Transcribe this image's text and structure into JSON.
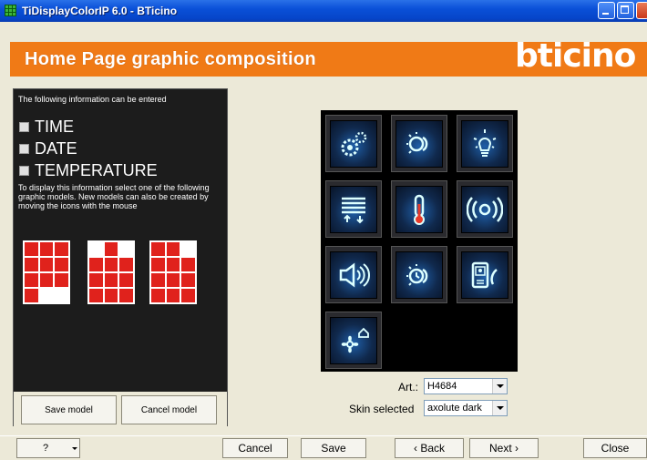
{
  "window": {
    "title": "TiDisplayColorIP 6.0 - BTicino"
  },
  "header": {
    "title": "Home Page graphic composition",
    "brand": "bticino"
  },
  "left_panel": {
    "info": "The following information can be entered",
    "options": [
      "TIME",
      "DATE",
      "TEMPERATURE"
    ],
    "description": "To display this information select one of the following graphic models. New models can also be created by moving the icons with the mouse",
    "save_model": "Save model",
    "cancel_model": "Cancel model",
    "colors": {
      "model_fill": "#e0221c",
      "panel_bg": "#1c1c1c"
    }
  },
  "icons": [
    "gear-settings-icon",
    "light-scenario-icon",
    "light-bulb-icon",
    "shutter-icon",
    "thermometer-icon",
    "broadcast-signal-icon",
    "speaker-icon",
    "timed-scenario-icon",
    "video-intercom-icon",
    "flower-home-icon"
  ],
  "settings": {
    "art_label": "Art.:",
    "art_value": "H4684",
    "skin_label": "Skin selected",
    "skin_value": "axolute dark"
  },
  "bottom": {
    "help": "?",
    "cancel": "Cancel",
    "save": "Save",
    "back": "‹ Back",
    "next": "Next ›",
    "close": "Close"
  },
  "colors": {
    "header_orange": "#f07a16",
    "titlebar_blue": "#0a50d8",
    "icon_glow": "#1f5fa8"
  }
}
